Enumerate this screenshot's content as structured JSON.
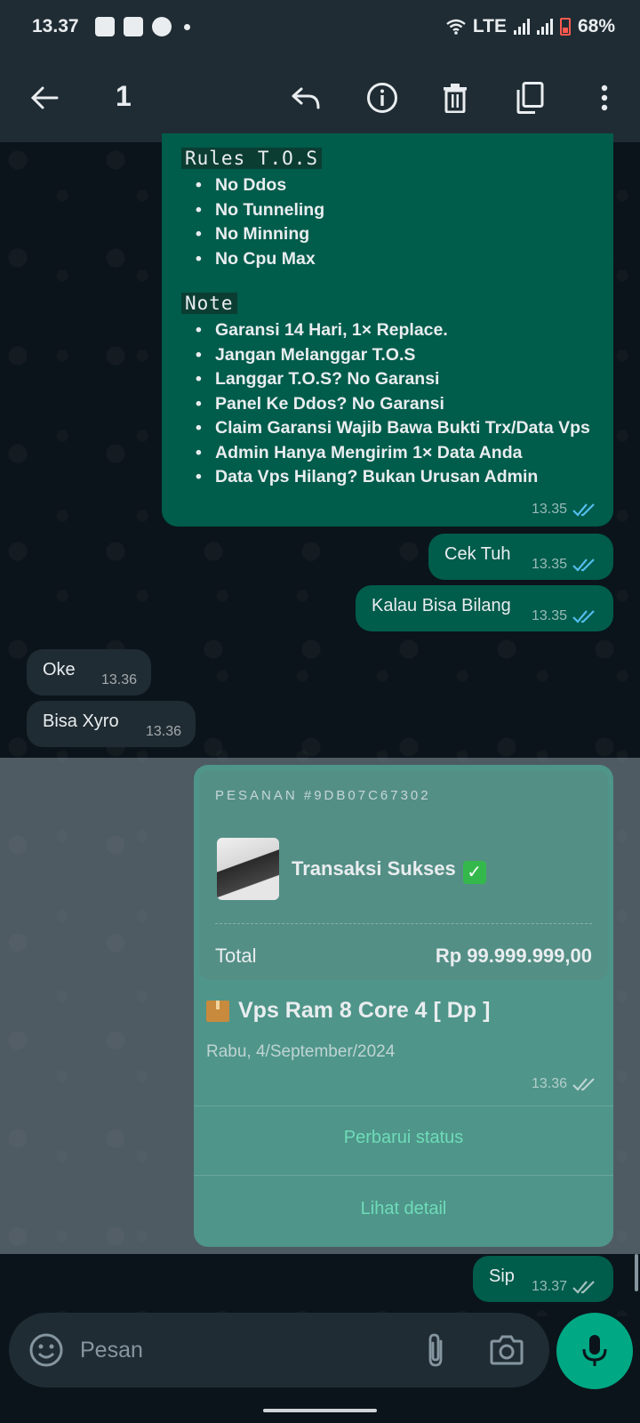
{
  "status_bar": {
    "time": "13.37",
    "network": "LTE",
    "battery": "68%"
  },
  "toolbar": {
    "selected_count": "1",
    "icons": [
      "back-arrow-icon",
      "reply-icon",
      "info-icon",
      "delete-icon",
      "copy-icon",
      "more-vert-icon"
    ]
  },
  "messages": {
    "rules_card": {
      "rules_heading": "Rules T.O.S",
      "rules": [
        "No Ddos",
        "No Tunneling",
        "No Minning",
        "No Cpu Max"
      ],
      "note_heading": "Note",
      "notes": [
        "Garansi 14 Hari, 1× Replace.",
        "Jangan Melanggar T.O.S",
        "Langgar T.O.S? No Garansi",
        "Panel Ke Ddos? No Garansi",
        "Claim Garansi Wajib Bawa Bukti Trx/Data Vps",
        "Admin Hanya Mengirim 1× Data Anda",
        "Data Vps Hilang? Bukan Urusan Admin"
      ],
      "time": "13.35"
    },
    "out1": {
      "text": "Cek Tuh",
      "time": "13.35"
    },
    "out2": {
      "text": "Kalau Bisa Bilang",
      "time": "13.35"
    },
    "in1": {
      "text": "Oke",
      "time": "13.36"
    },
    "in2": {
      "text": "Bisa Xyro",
      "time": "13.36"
    },
    "order": {
      "order_id": "PESANAN #9DB07C67302",
      "status": "Transaksi Sukses",
      "status_emoji": "✅",
      "total_label": "Total",
      "total_value": "Rp 99.999.999,00",
      "product_emoji": "📦",
      "product": "Vps Ram 8 Core 4 [ Dp ]",
      "date": "Rabu, 4/September/2024",
      "time": "13.36",
      "action_update": "Perbarui status",
      "action_detail": "Lihat detail"
    },
    "out3": {
      "text": "Sip",
      "time": "13.37"
    }
  },
  "composer": {
    "placeholder": "Pesan"
  },
  "colors": {
    "outgoing_bubble": "#005c4b",
    "incoming_bubble": "#202c33",
    "header": "#1f2c34",
    "accent": "#00a884",
    "read_tick": "#53bdeb"
  }
}
